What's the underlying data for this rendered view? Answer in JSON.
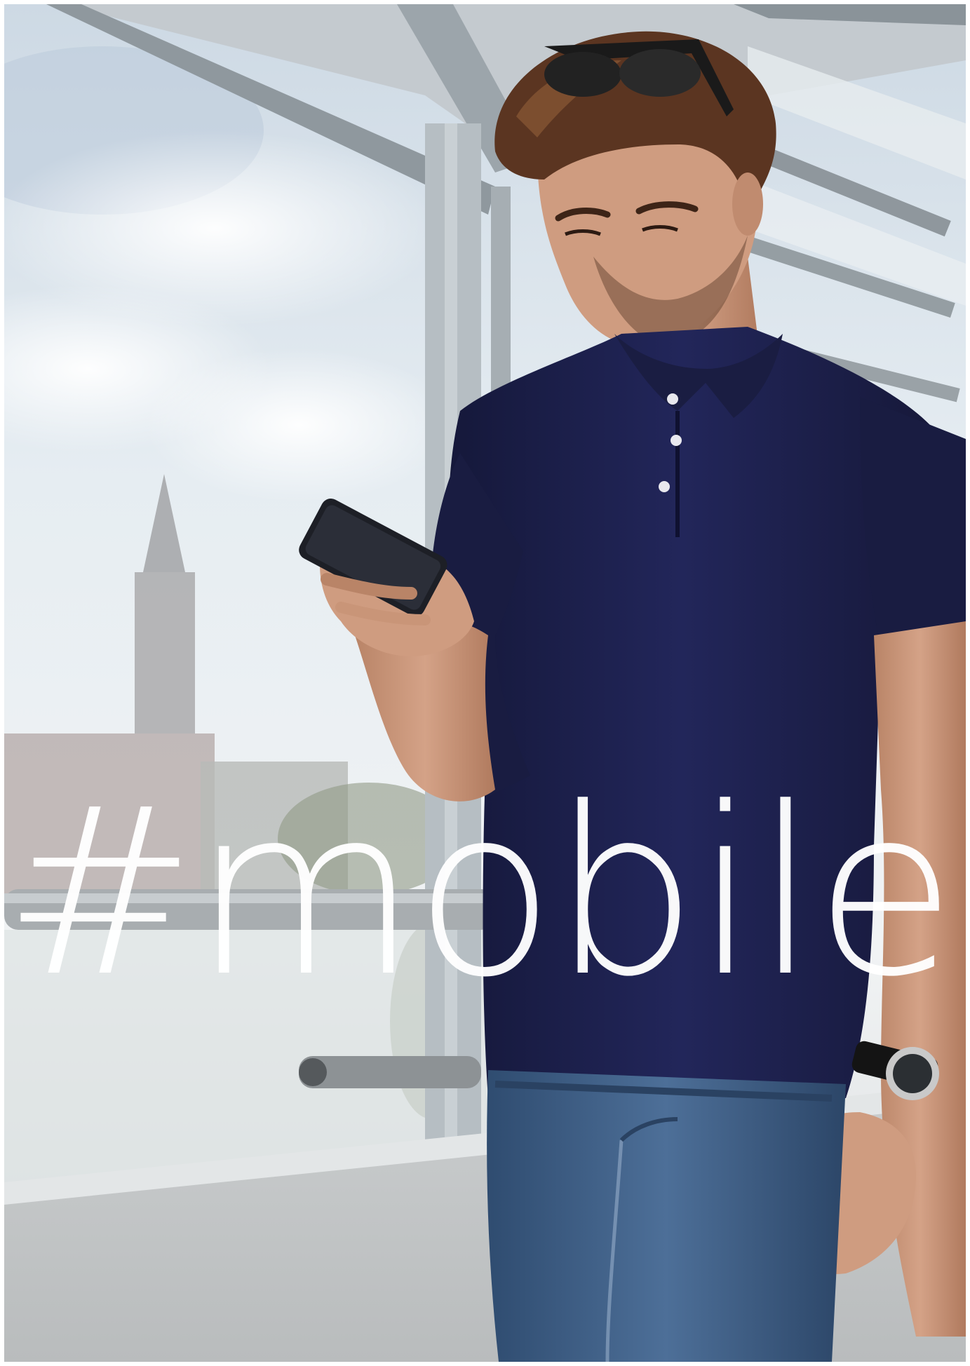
{
  "headline": "#mobile",
  "colors": {
    "sky": "#dfe7ee",
    "frame": "#a9b2b8",
    "polo": "#1c1f45",
    "jeans": "#3e5f86",
    "skin": "#c99578",
    "hair": "#5b3521",
    "headline_text": "#ffffff"
  }
}
